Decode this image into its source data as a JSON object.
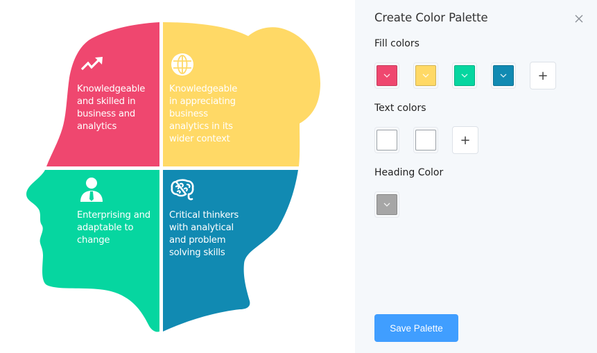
{
  "infographic": {
    "quadrants": [
      {
        "id": "top-left",
        "icon": "trending-up-icon",
        "color": "#ef476f",
        "text": [
          "Knowledgeable",
          "and skilled in",
          "business and",
          "analytics"
        ]
      },
      {
        "id": "top-right",
        "icon": "globe-icon",
        "color": "#ffd966",
        "text": [
          "Knowledgeable",
          "in appreciating",
          "business",
          "analytics in its",
          "wider context"
        ]
      },
      {
        "id": "bottom-left",
        "icon": "businessman-icon",
        "color": "#06d6a0",
        "text": [
          "Enterprising and",
          "adaptable to",
          "change"
        ]
      },
      {
        "id": "bottom-right",
        "icon": "brain-icon",
        "color": "#118ab2",
        "text": [
          "Critical thinkers",
          "with analytical",
          "and problem",
          "solving skills"
        ]
      }
    ]
  },
  "panel": {
    "title": "Create Color Palette",
    "close_icon": "close-icon",
    "fill_colors": {
      "label": "Fill colors",
      "swatches": [
        "#ef476f",
        "#ffd966",
        "#06d6a0",
        "#118ab2"
      ],
      "add_label": "+"
    },
    "text_colors": {
      "label": "Text colors",
      "swatches": [
        "#ffffff",
        "#ffffff"
      ],
      "add_label": "+"
    },
    "heading_color": {
      "label": "Heading Color",
      "swatches": [
        "#a6a6a6"
      ]
    },
    "save_label": "Save Palette"
  }
}
